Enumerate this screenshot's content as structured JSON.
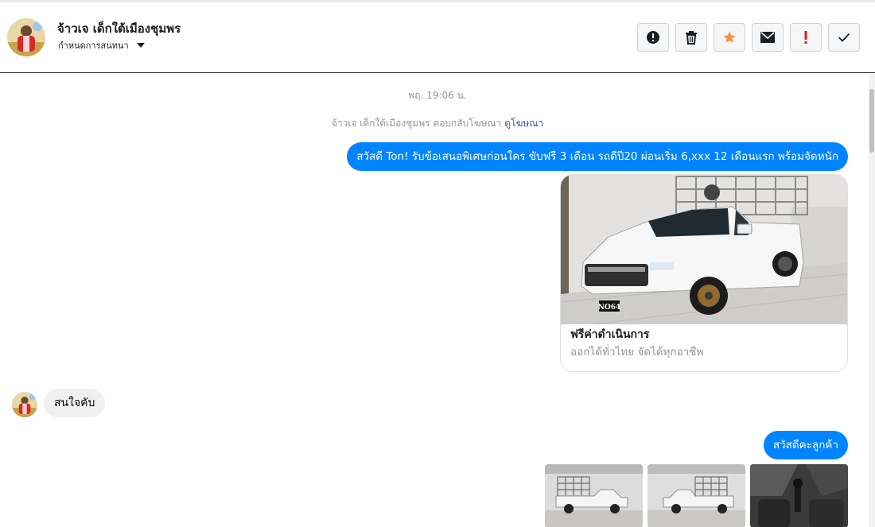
{
  "header": {
    "contact_name": "จ้าวเจ เด็กใต้เมืองชุมพร",
    "assign_label": "กำหนดการสนทนา",
    "icons": [
      "alert-icon",
      "trash-icon",
      "star-icon",
      "envelope-icon",
      "exclamation-icon",
      "check-icon"
    ]
  },
  "thread": {
    "timestamp": "พฤ. 19:06 น.",
    "reply_note": "จ้าวเจ เด็กใต้เมืองชุมพร ตอบกลับโฆษณา",
    "reply_link": "ดูโฆษณา",
    "messages": {
      "ad_message": "สวัสดี Ton! รับข้อเสนอพิเศษก่อนใคร ขับฟรี 3 เดือน รถดีปี20 ผ่อนเริ่ม 6,xxx 12 เดือนแรก  พร้อมจัดหนัก",
      "card_title": "ฟรีค่าดำเนินการ",
      "card_subtitle": "ออกได้ทั่วไทย จัดได้ทุกอาชีพ",
      "card_plate": "NO64",
      "incoming": "สนใจคับ",
      "greeting": "สวัสดีคะลูกค้า"
    }
  },
  "colors": {
    "outgoing_bubble": "#0084ff",
    "incoming_bubble": "#f0f0f0",
    "star": "#f7923a",
    "exclamation": "#e02020"
  }
}
